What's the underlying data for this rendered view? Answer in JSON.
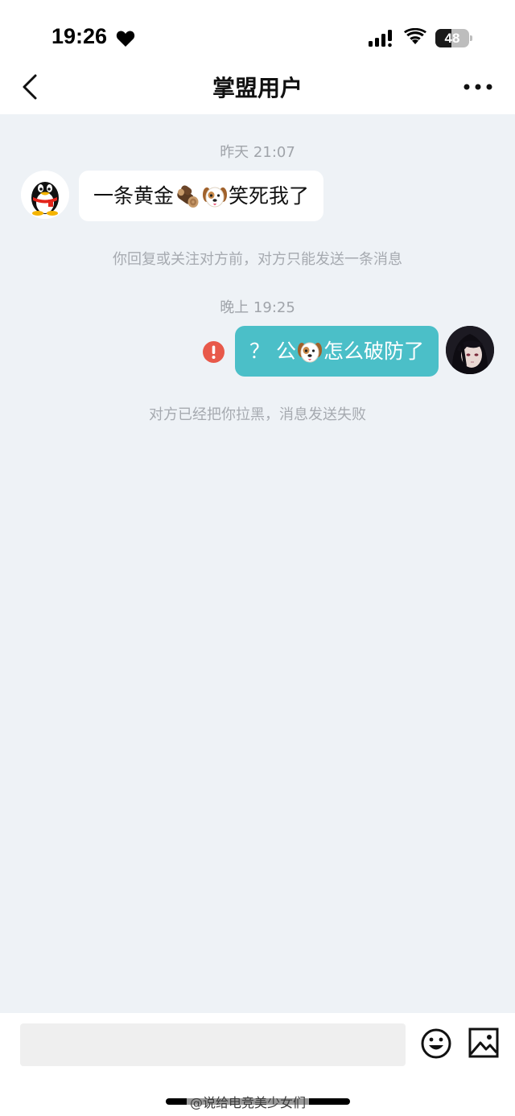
{
  "status_bar": {
    "time": "19:26",
    "battery_level": "48",
    "battery_fraction": 0.48
  },
  "nav": {
    "title": "掌盟用户"
  },
  "chat": {
    "timestamp_1": "昨天 21:07",
    "incoming_message": {
      "text_before": "一条黄金",
      "emojis": [
        "log-emoji",
        "dog-face-emoji"
      ],
      "text_after": "笑死我了"
    },
    "system_note_1": "你回复或关注对方前，对方只能发送一条消息",
    "timestamp_2": "晚上 19:25",
    "outgoing_message": {
      "text_before": "？ 公",
      "emoji": "dog-face-emoji",
      "text_after": "怎么破防了",
      "status": "failed",
      "status_color": "#e8594a"
    },
    "system_note_2": "对方已经把你拉黑，消息发送失败"
  },
  "input_bar": {
    "placeholder": "",
    "value": ""
  },
  "watermark": "@说给电竞美少女们",
  "colors": {
    "outgoing_bubble": "#4bbfc8",
    "incoming_bubble": "#ffffff",
    "chat_background": "#eef2f6"
  }
}
